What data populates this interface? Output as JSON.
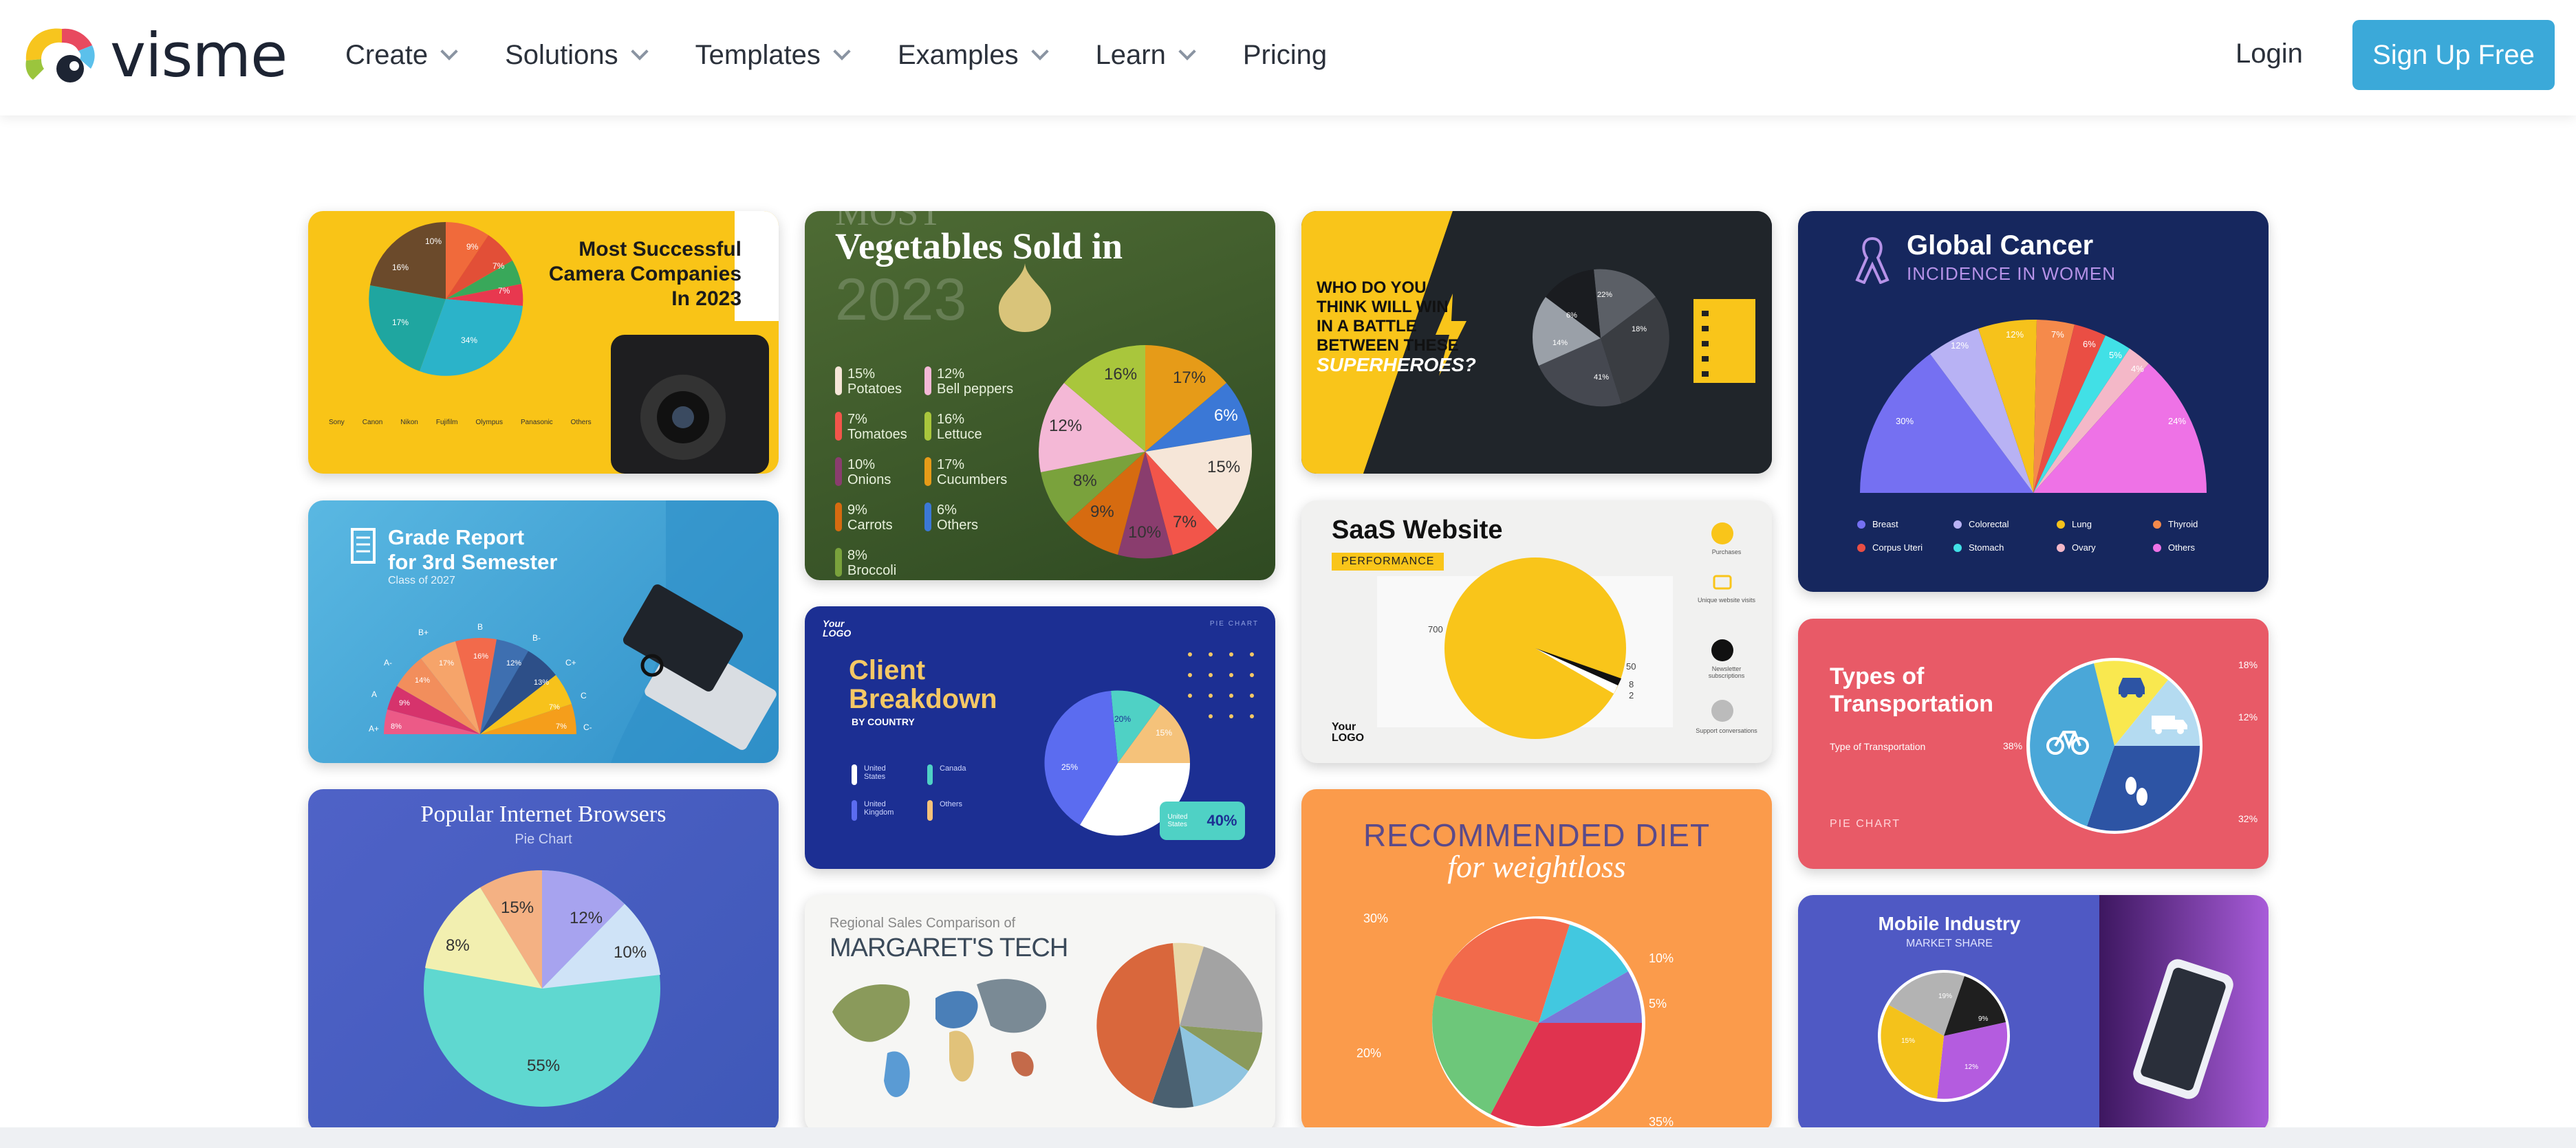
{
  "brand": {
    "name": "visme",
    "accent": "#3ba9d9"
  },
  "nav": {
    "items": [
      {
        "label": "Create"
      },
      {
        "label": "Solutions"
      },
      {
        "label": "Templates"
      },
      {
        "label": "Examples"
      },
      {
        "label": "Learn"
      }
    ],
    "pricing": "Pricing",
    "login": "Login",
    "signup": "Sign Up Free"
  },
  "cards": {
    "camera": {
      "title_l1": "Most Successful",
      "title_l2": "Camera Companies",
      "title_l3": "In 2023",
      "slices": [
        "10%",
        "9%",
        "7%",
        "7%",
        "16%",
        "17%",
        "34%"
      ],
      "legend": [
        "Sony",
        "Canon",
        "Nikon",
        "Fujifilm",
        "Olympus",
        "Panasonic",
        "Others"
      ]
    },
    "veg": {
      "title_top": "MOST",
      "title": "Vegetables Sold in",
      "year": "2023",
      "items": [
        {
          "pct": "15%",
          "name": "Potatoes"
        },
        {
          "pct": "7%",
          "name": "Tomatoes"
        },
        {
          "pct": "10%",
          "name": "Onions"
        },
        {
          "pct": "9%",
          "name": "Carrots"
        },
        {
          "pct": "8%",
          "name": "Broccoli"
        },
        {
          "pct": "12%",
          "name": "Bell peppers"
        },
        {
          "pct": "16%",
          "name": "Lettuce"
        },
        {
          "pct": "17%",
          "name": "Cucumbers"
        },
        {
          "pct": "6%",
          "name": "Others"
        }
      ],
      "labels": [
        "16%",
        "17%",
        "6%",
        "15%",
        "12%",
        "8%",
        "9%",
        "10%",
        "7%"
      ]
    },
    "heroes": {
      "line1": "WHO DO YOU",
      "line2": "THINK WILL WIN",
      "line3": "IN A BATTLE",
      "line4": "BETWEEN THESE",
      "line5": "SUPERHEROES?",
      "labels": [
        "22%",
        "18%",
        "6%",
        "14%",
        "41%"
      ]
    },
    "cancer": {
      "title": "Global Cancer",
      "subtitle": "INCIDENCE IN WOMEN",
      "labels": [
        "30%",
        "12%",
        "12%",
        "7%",
        "6%",
        "5%",
        "4%",
        "24%"
      ],
      "legend": [
        "Breast",
        "Colorectal",
        "Lung",
        "Thyroid",
        "Corpus Uteri",
        "Stomach",
        "Ovary",
        "Others"
      ]
    },
    "grade": {
      "title_l1": "Grade Report",
      "title_l2": "for 3rd Semester",
      "class": "Class of 2027",
      "grades": [
        "A+",
        "A",
        "A-",
        "B+",
        "B",
        "B-",
        "C+",
        "C",
        "C-"
      ],
      "labels": [
        "8%",
        "9%",
        "14%",
        "17%",
        "16%",
        "12%",
        "13%",
        "7%",
        "7%"
      ]
    },
    "saas": {
      "title": "SaaS Website",
      "badge": "PERFORMANCE",
      "logo_l1": "Your",
      "logo_l2": "LOGO",
      "values": [
        "700",
        "50",
        "8",
        "2"
      ],
      "legend": [
        "Purchases",
        "Unique website visits",
        "Newsletter subscriptions",
        "Support conversations"
      ]
    },
    "client": {
      "logo_l1": "Your",
      "logo_l2": "LOGO",
      "tag": "PIE CHART",
      "title_l1": "Client",
      "title_l2": "Breakdown",
      "subtitle": "BY COUNTRY",
      "legend": [
        "United States",
        "Canada",
        "United Kingdom",
        "Others"
      ],
      "labels": [
        "20%",
        "15%",
        "25%",
        "40%"
      ],
      "callout_label": "United States",
      "callout_value": "40%"
    },
    "transport": {
      "title_l1": "Types of",
      "title_l2": "Transportation",
      "subtitle": "Type of Transportation",
      "tag": "PIE CHART",
      "labels": [
        "18%",
        "12%",
        "32%",
        "38%"
      ]
    },
    "browsers": {
      "title": "Popular Internet Browsers",
      "subtitle": "Pie Chart",
      "labels": [
        "15%",
        "12%",
        "8%",
        "10%",
        "55%"
      ]
    },
    "regional": {
      "subtitle": "Regional Sales Comparison of",
      "title": "MARGARET'S TECH"
    },
    "diet": {
      "title": "RECOMMENDED DIET",
      "subtitle": "for weightloss",
      "labels": [
        "30%",
        "10%",
        "5%",
        "20%",
        "35%"
      ]
    },
    "mobile": {
      "title": "Mobile Industry",
      "subtitle": "MARKET SHARE",
      "labels": [
        "19%",
        "9%",
        "15%",
        "12%"
      ]
    }
  }
}
